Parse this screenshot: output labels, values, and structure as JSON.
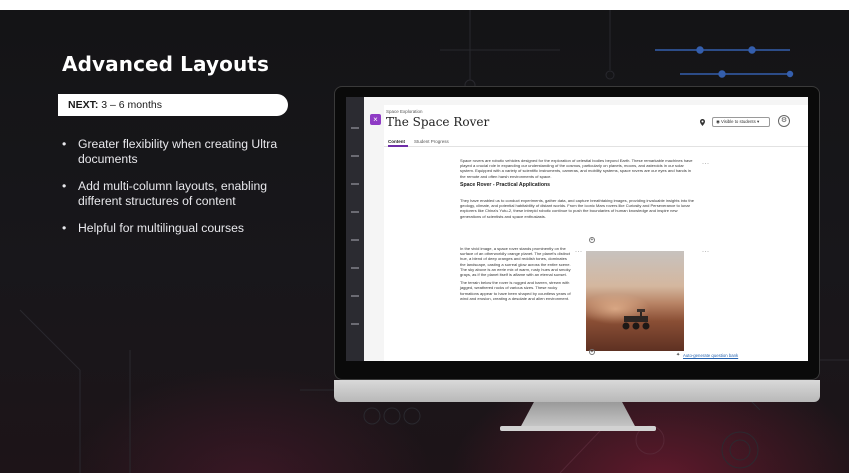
{
  "slide": {
    "title": "Advanced Layouts",
    "next_label": "NEXT:",
    "next_value": " 3 – 6 months",
    "bullets": [
      "Greater flexibility when creating Ultra documents",
      "Add multi-column layouts, enabling different structures of content",
      "Helpful for multilingual courses"
    ]
  },
  "screen": {
    "breadcrumb": "Space Exploration",
    "page_title": "The Space Rover",
    "close_glyph": "×",
    "visibility_label": "Visible to students",
    "tabs": [
      "Content",
      "Student Progress"
    ],
    "intro_paragraph": "Space rovers are robotic vehicles designed for the exploration of celestial bodies beyond Earth. These remarkable machines have played a crucial role in expanding our understanding of the cosmos, particularly on planets, moons, and asteroids in our solar system. Equipped with a variety of scientific instruments, cameras, and mobility systems, space rovers are our eyes and hands in the remote and often harsh environments of space.",
    "subheading": "Space Rover - Practical Applications",
    "applications_paragraph": "They have enabled us to conduct experiments, gather data, and capture breathtaking images, providing invaluable insights into the geology, climate, and potential habitability of distant worlds. From the iconic Mars rovers like Curiosity and Perseverance to lunar explorers like China's Yutu-2, these intrepid robotic continue to push the boundaries of human knowledge and inspire new generations of scientists and space enthusiasts.",
    "column_paragraph_1": "In the vivid image, a space rover stands prominently on the surface of an otherworldly orange planet. The planet's distinct hue, a blend of deep oranges and reddish tones, dominates the landscape, casting a surreal glow across the entire scene. The sky above is an eerie mix of warm, rusty hues and smoky grays, as if the planet itself is aflame with an eternal sunset.",
    "column_paragraph_2": "The terrain below the rover is rugged and barren, strewn with jagged, weathered rocks of various sizes. These rocky formations appear to have been shaped by countless years of wind and erosion, creating a desolate and alien environment.",
    "auto_generate_link": "Auto-generate question bank",
    "icons": {
      "location": "location-pin-icon",
      "visibility": "eye-icon",
      "settings": "gear-icon",
      "more": "ellipsis-icon",
      "add": "plus-circle-icon",
      "magic": "sparkle-wand-icon"
    }
  },
  "colors": {
    "background": "#141416",
    "accent_purple": "#8f3bc5",
    "link_blue": "#2563b0"
  }
}
